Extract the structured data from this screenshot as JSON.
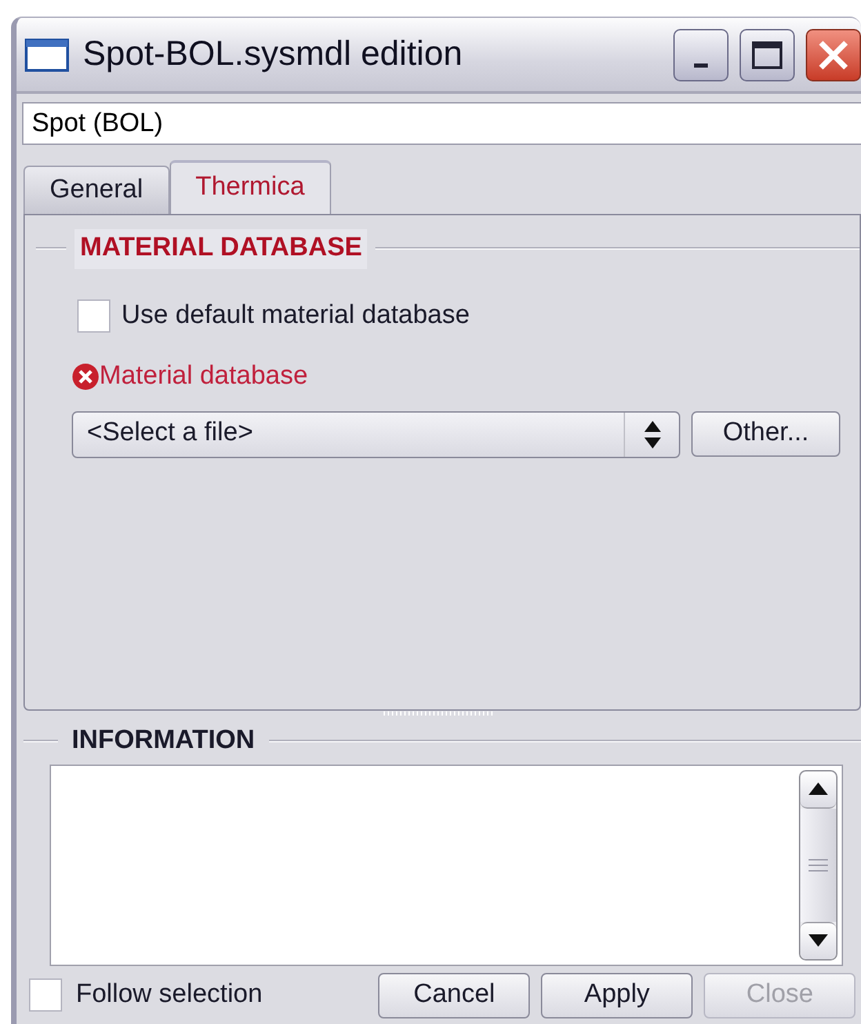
{
  "window": {
    "title": "Spot-BOL.sysmdl edition"
  },
  "name_field": {
    "value": "Spot (BOL)"
  },
  "tabs": [
    {
      "label": "General",
      "selected": false
    },
    {
      "label": "Thermica",
      "selected": true
    }
  ],
  "material_group": {
    "title": "MATERIAL DATABASE",
    "use_default": {
      "label": "Use default material database",
      "checked": false
    },
    "database": {
      "label": "Material database",
      "error": true,
      "value": "<Select a file>",
      "other_button": "Other..."
    }
  },
  "information": {
    "title": "INFORMATION"
  },
  "follow_selection": {
    "label": "Follow selection",
    "checked": false
  },
  "buttons": [
    {
      "label": "Cancel",
      "disabled": false
    },
    {
      "label": "Apply",
      "disabled": false
    },
    {
      "label": "Close",
      "disabled": true
    }
  ]
}
